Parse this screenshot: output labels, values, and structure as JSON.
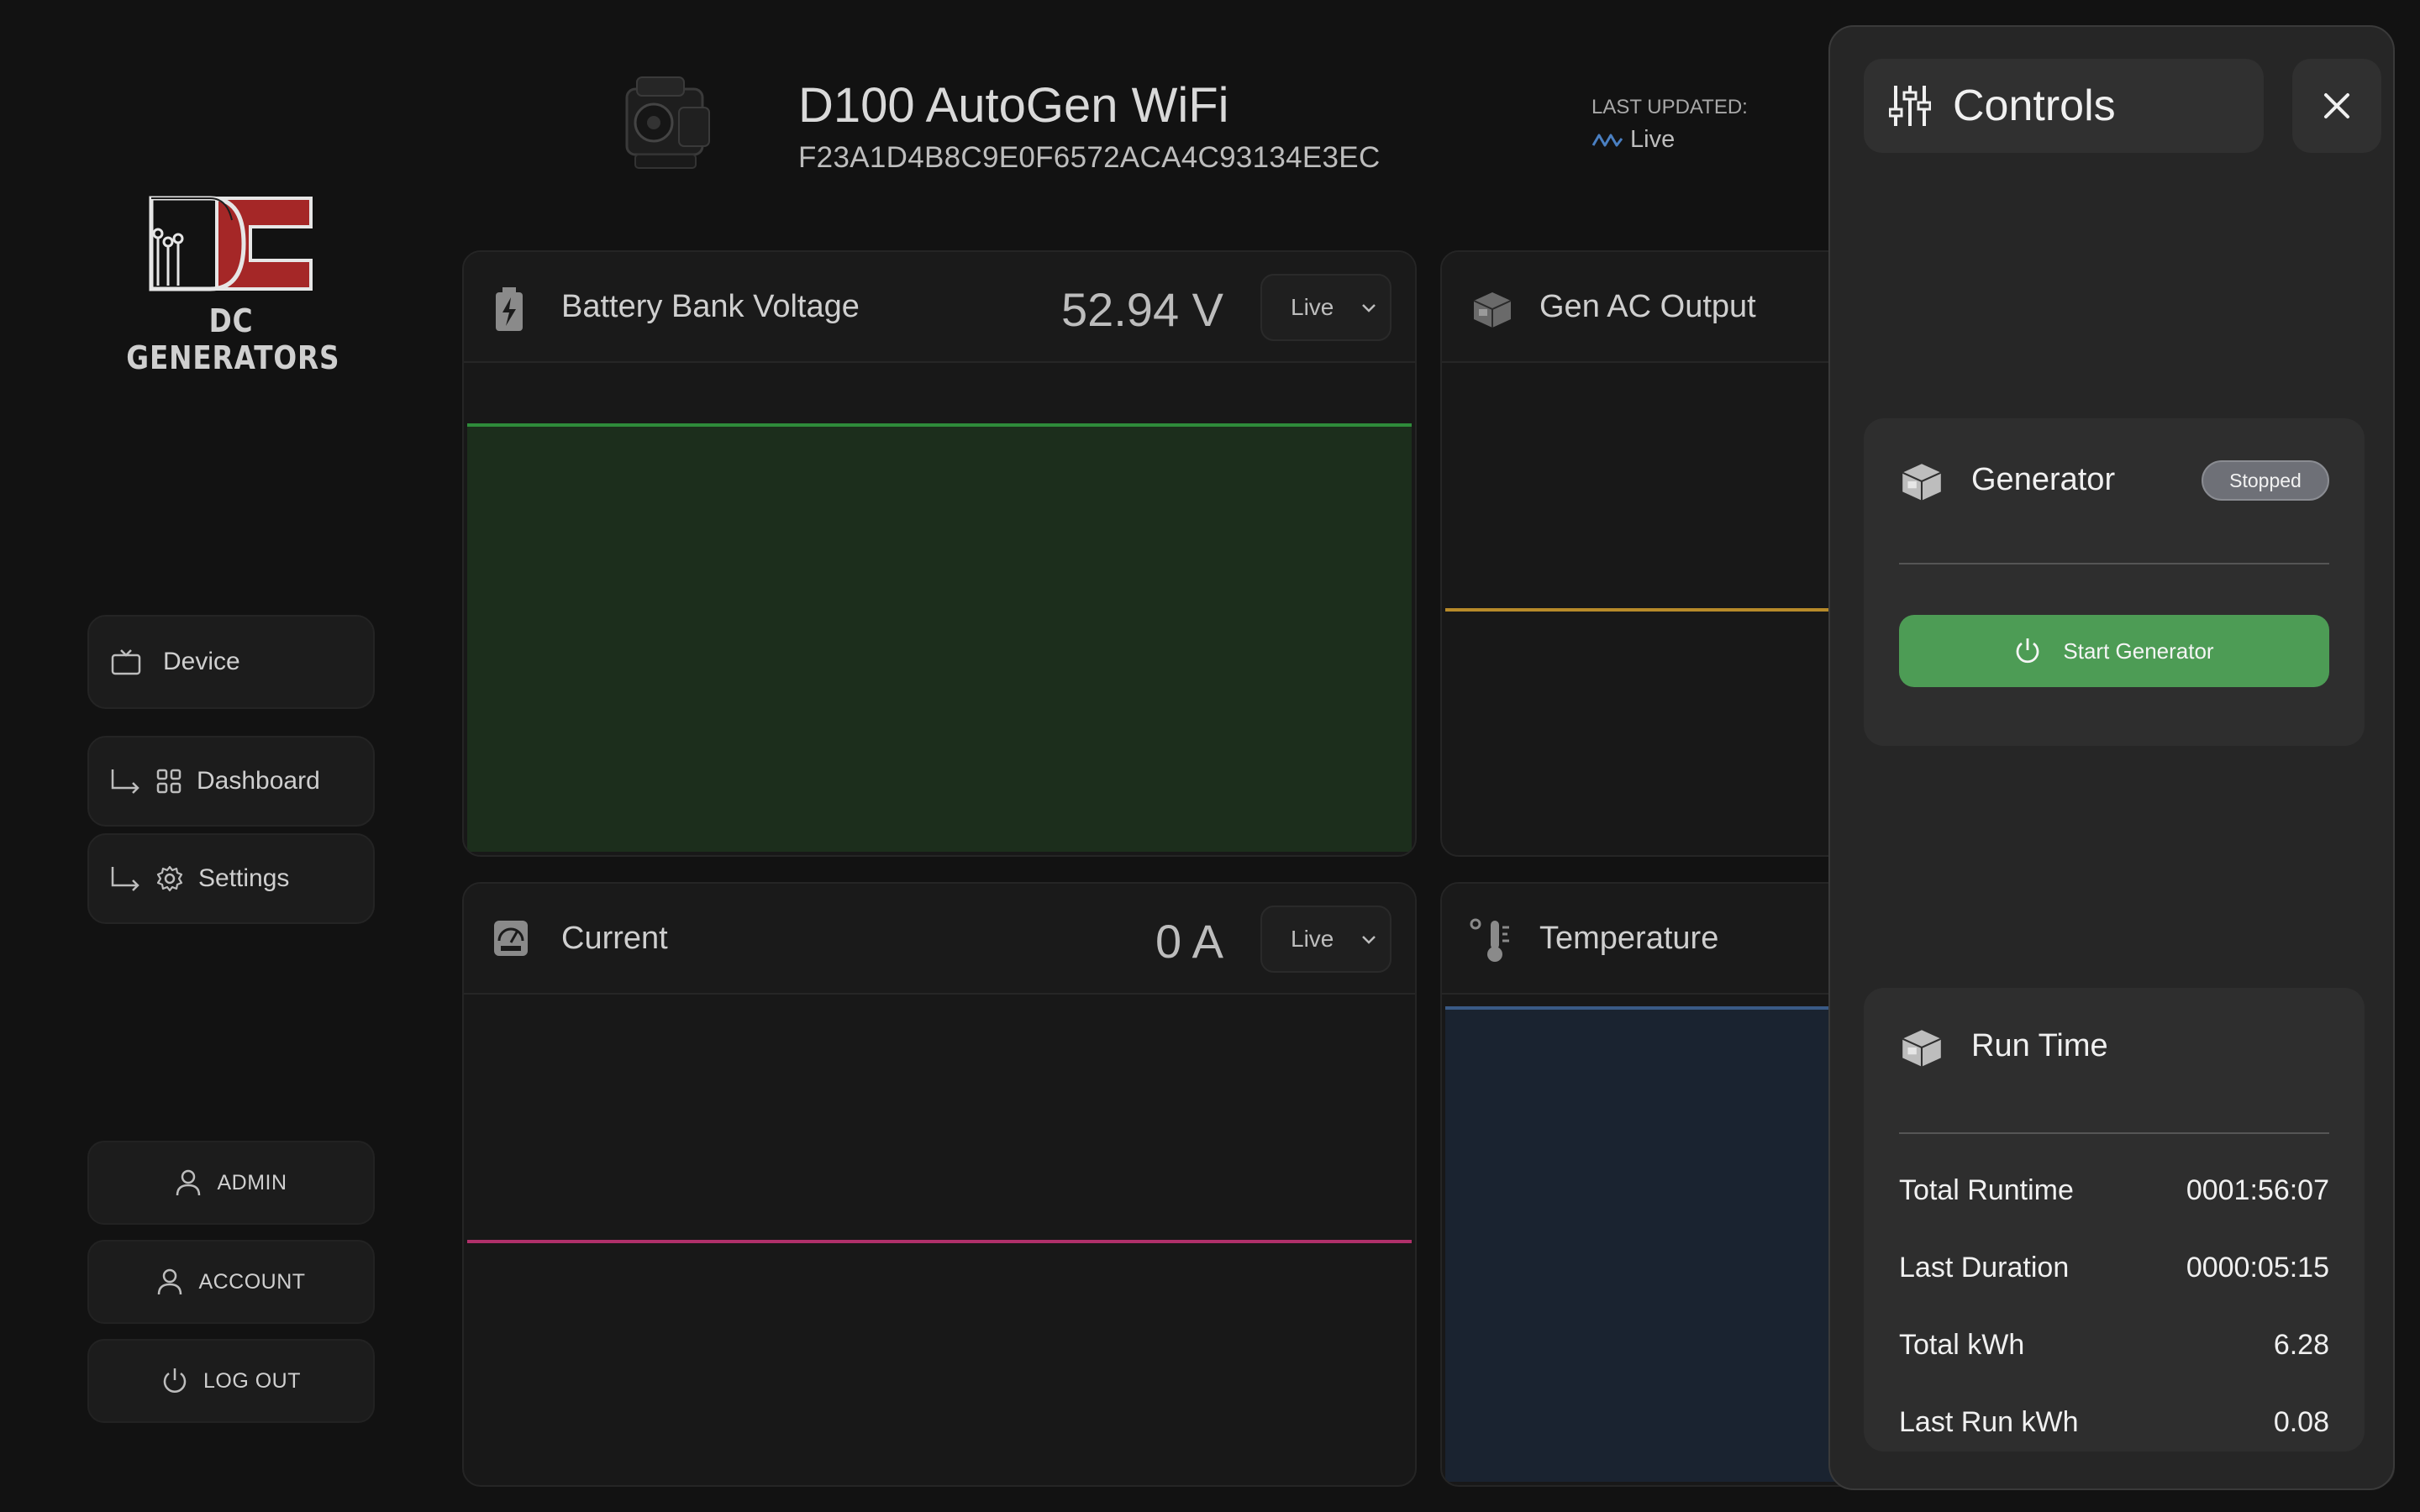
{
  "brand": {
    "logo_text": "DC GENERATORS"
  },
  "sidebar": {
    "device_label": "Device",
    "dashboard_label": "Dashboard",
    "settings_label": "Settings",
    "admin_label": "ADMIN",
    "account_label": "ACCOUNT",
    "logout_label": "LOG OUT"
  },
  "header": {
    "device_name": "D100 AutoGen WiFi",
    "device_id": "F23A1D4B8C9E0F6572ACA4C93134E3EC",
    "last_updated_label": "LAST UPDATED:",
    "last_updated_value": "Live"
  },
  "cards": {
    "battery": {
      "title": "Battery Bank Voltage",
      "value": "52.94 V",
      "range": "Live",
      "color": "#2e8b3a"
    },
    "gen_ac": {
      "title": "Gen AC Output",
      "color": "#b78a2a"
    },
    "current": {
      "title": "Current",
      "value": "0 A",
      "range": "Live",
      "color": "#b0306a"
    },
    "temperature": {
      "title": "Temperature",
      "color": "#3a5a86"
    }
  },
  "controls": {
    "title": "Controls",
    "generator": {
      "title": "Generator",
      "status": "Stopped",
      "start_label": "Start Generator"
    },
    "run_time": {
      "title": "Run Time",
      "rows": [
        {
          "label": "Total Runtime",
          "value": "0001:56:07"
        },
        {
          "label": "Last Duration",
          "value": "0000:05:15"
        },
        {
          "label": "Total kWh",
          "value": "6.28"
        },
        {
          "label": "Last Run kWh",
          "value": "0.08"
        }
      ]
    }
  },
  "colors": {
    "accent_green": "#4d9c55",
    "logo_red": "#a52727"
  }
}
